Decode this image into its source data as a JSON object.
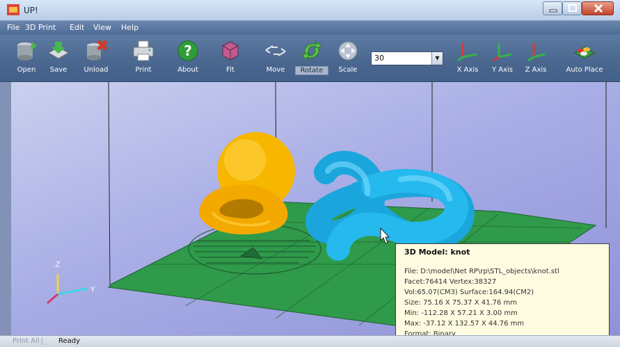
{
  "window": {
    "title": "UP!"
  },
  "menu": [
    "File",
    "3D Print",
    "Edit",
    "View",
    "Help"
  ],
  "toolbar": {
    "open": "Open",
    "save": "Save",
    "unload": "Unload",
    "print": "Print",
    "about": "About",
    "fit": "Fit",
    "move": "Move",
    "rotate": "Rotate",
    "scale": "Scale",
    "zoom_value": "30",
    "x_axis": "X Axis",
    "y_axis": "Y Axis",
    "z_axis": "Z Axis",
    "auto_place": "Auto Place",
    "active_tool": "Rotate"
  },
  "viewport": {
    "axis_z": "Z",
    "axis_y": "Y",
    "model_colors": {
      "yellow_model": "#f5b400",
      "knot_model": "#22b8ee",
      "platform": "#2f9a4a"
    }
  },
  "info": {
    "title": "3D Model: knot",
    "file": "File: D:\\model\\Net RP\\rp\\STL_objects\\knot.stl",
    "facet_vertex": "Facet:76414    Vertex:38327",
    "vol_surface": "Vol:65.07(CM3)    Surface:164.94(CM2)",
    "size": "Size:  75.16 X  75.37 X  41.76 mm",
    "min": "Min:  -112.28 X  57.21 X    3.00 mm",
    "max": "Max:  -37.12 X 132.57 X  44.76 mm",
    "format": "Format: Binary"
  },
  "status": {
    "print_all": "Print All",
    "text": "Ready"
  }
}
